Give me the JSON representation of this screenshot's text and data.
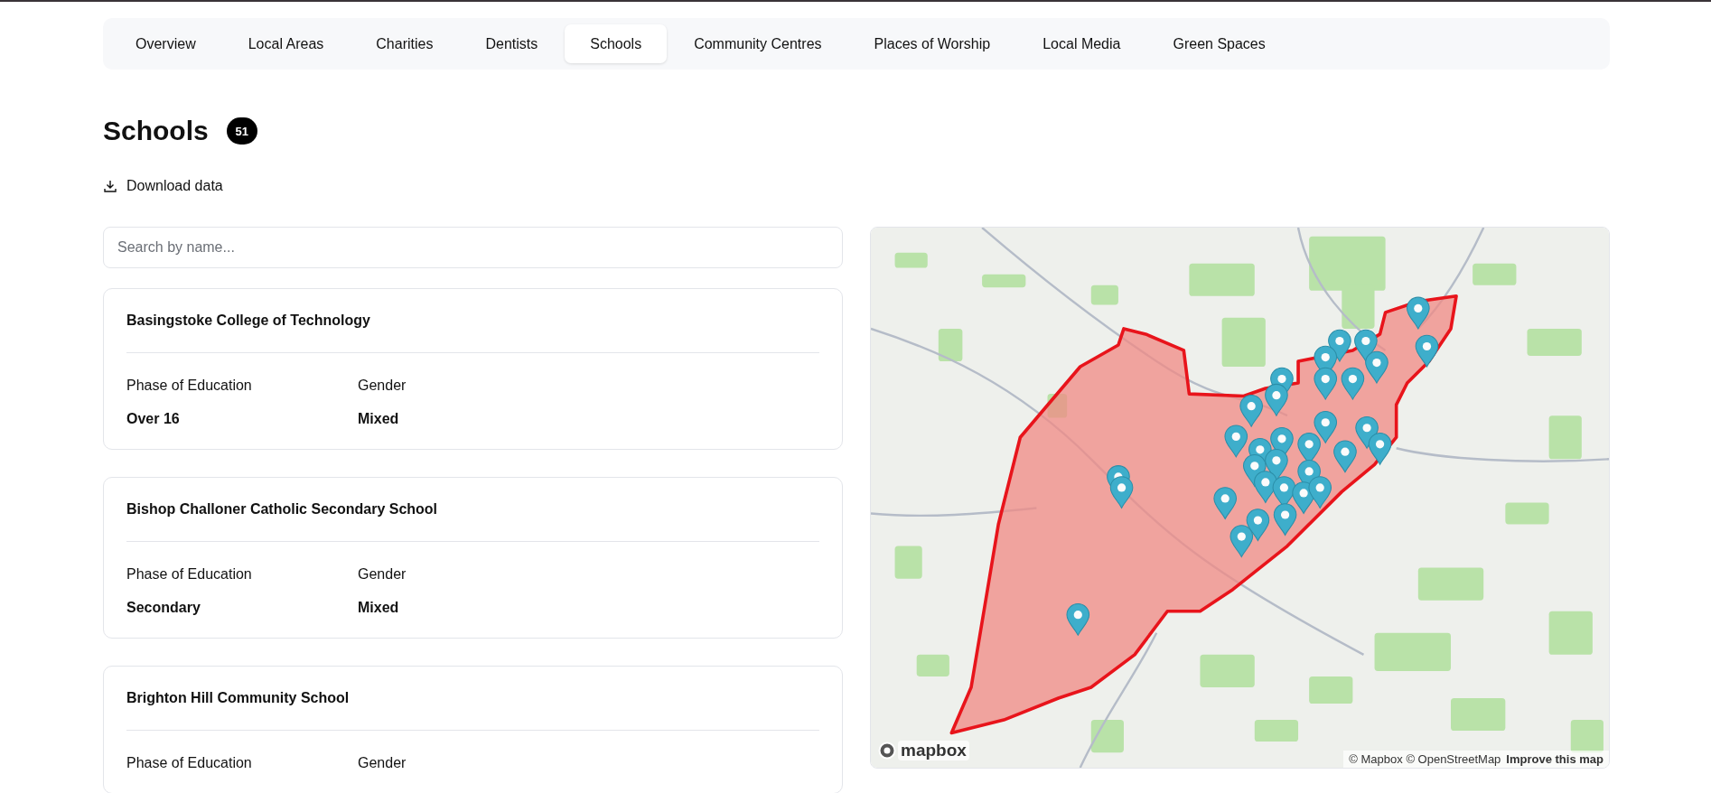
{
  "tabs": [
    {
      "label": "Overview",
      "selected": false
    },
    {
      "label": "Local Areas",
      "selected": false
    },
    {
      "label": "Charities",
      "selected": false
    },
    {
      "label": "Dentists",
      "selected": false
    },
    {
      "label": "Schools",
      "selected": true
    },
    {
      "label": "Community Centres",
      "selected": false
    },
    {
      "label": "Places of Worship",
      "selected": false
    },
    {
      "label": "Local Media",
      "selected": false
    },
    {
      "label": "Green Spaces",
      "selected": false
    }
  ],
  "heading": {
    "title": "Schools",
    "count": "51"
  },
  "download": {
    "label": "Download data"
  },
  "search": {
    "placeholder": "Search by name..."
  },
  "schools": [
    {
      "name": "Basingstoke College of Technology",
      "fields": [
        {
          "label": "Phase of Education",
          "value": "Over 16"
        },
        {
          "label": "Gender",
          "value": "Mixed"
        }
      ]
    },
    {
      "name": "Bishop Challoner Catholic Secondary School",
      "fields": [
        {
          "label": "Phase of Education",
          "value": "Secondary"
        },
        {
          "label": "Gender",
          "value": "Mixed"
        }
      ]
    },
    {
      "name": "Brighton Hill Community School",
      "fields": [
        {
          "label": "Phase of Education"
        },
        {
          "label": "Gender"
        }
      ]
    }
  ],
  "map": {
    "logo": "mapbox",
    "attribution": "© Mapbox © OpenStreetMap",
    "improve_link": "Improve this map"
  }
}
